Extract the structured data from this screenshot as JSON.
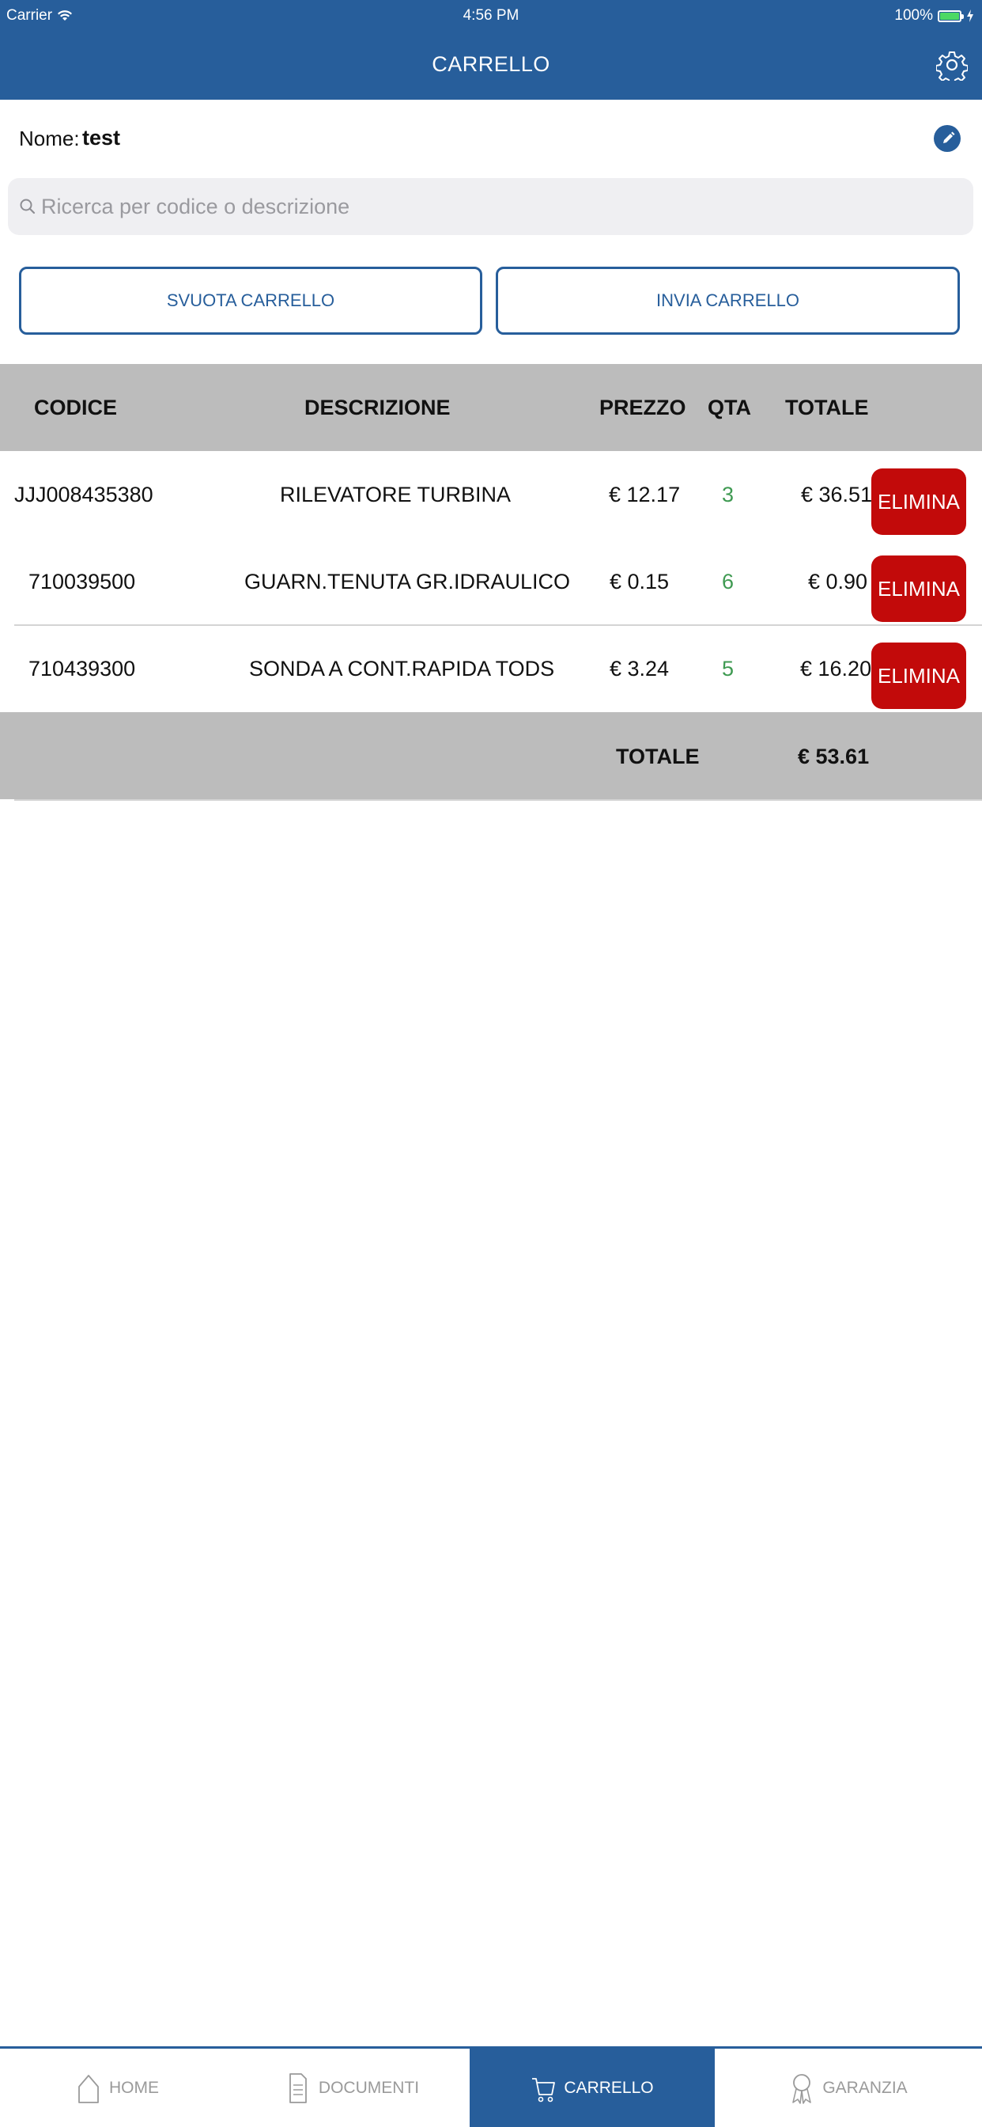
{
  "status": {
    "carrier": "Carrier",
    "time": "4:56 PM",
    "battery": "100%"
  },
  "nav": {
    "title": "CARRELLO",
    "settings_icon": "gear-icon"
  },
  "customer": {
    "label": "Nome:",
    "value": "test",
    "edit_icon": "pencil-icon"
  },
  "search": {
    "placeholder": "Ricerca per codice o descrizione",
    "value": ""
  },
  "actions": {
    "empty_cart": "SVUOTA CARRELLO",
    "send_cart": "INVIA CARRELLO"
  },
  "table": {
    "headers": {
      "code": "CODICE",
      "description": "DESCRIZIONE",
      "price": "PREZZO",
      "qty": "QTA",
      "total": "TOTALE"
    },
    "rows": [
      {
        "code": "JJJ008435380",
        "description": "RILEVATORE TURBINA",
        "price": "€ 12.17",
        "qty": "3",
        "total": "€ 36.51",
        "action": "ELIMINA"
      },
      {
        "code": "710039500",
        "description": "GUARN.TENUTA GR.IDRAULICO",
        "price": "€ 0.15",
        "qty": "6",
        "total": "€ 0.90",
        "action": "ELIMINA"
      },
      {
        "code": "710439300",
        "description": "SONDA A CONT.RAPIDA TODS",
        "price": "€ 3.24",
        "qty": "5",
        "total": "€ 16.20",
        "action": "ELIMINA"
      }
    ],
    "footer": {
      "label": "TOTALE",
      "value": "€ 53.61"
    }
  },
  "tabs": [
    {
      "label": "HOME",
      "icon": "house-icon",
      "active": false
    },
    {
      "label": "DOCUMENTI",
      "icon": "document-icon",
      "active": false
    },
    {
      "label": "CARRELLO",
      "icon": "cart-icon",
      "active": true
    },
    {
      "label": "GARANZIA",
      "icon": "ribbon-icon",
      "active": false
    }
  ],
  "colors": {
    "primary": "#275e9b",
    "danger": "#c20a0a",
    "qty": "#3f9a52",
    "header_gray": "#bcbcbc"
  }
}
